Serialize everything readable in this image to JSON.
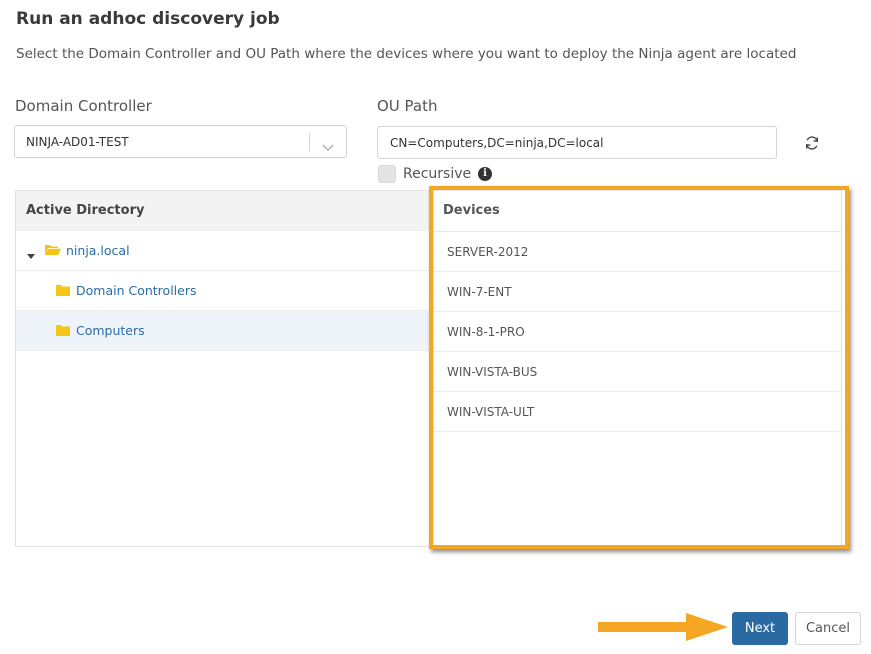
{
  "dialog": {
    "title": "Run an adhoc discovery job",
    "subtitle": "Select the Domain Controller and OU Path where the devices where you want to deploy the Ninja agent are located"
  },
  "domain_controller": {
    "label": "Domain Controller",
    "selected": "NINJA-AD01-TEST"
  },
  "ou_path": {
    "label": "OU Path",
    "value": "CN=Computers,DC=ninja,DC=local",
    "refresh_icon": "refresh-icon"
  },
  "recursive": {
    "label": "Recursive",
    "checked": false,
    "info_icon": "info-icon"
  },
  "active_directory": {
    "header": "Active Directory",
    "tree": [
      {
        "label": "ninja.local",
        "level": 0,
        "expanded": true,
        "icon": "folder-open-icon"
      },
      {
        "label": "Domain Controllers",
        "level": 1,
        "icon": "folder-icon"
      },
      {
        "label": "Computers",
        "level": 1,
        "icon": "folder-icon",
        "selected": true
      }
    ]
  },
  "devices": {
    "header": "Devices",
    "items": [
      "SERVER-2012",
      "WIN-7-ENT",
      "WIN-8-1-PRO",
      "WIN-VISTA-BUS",
      "WIN-VISTA-ULT"
    ]
  },
  "footer": {
    "next_label": "Next",
    "cancel_label": "Cancel"
  },
  "colors": {
    "primary": "#2a6aa3",
    "highlight": "#f5a623",
    "folder": "#f5c518",
    "link": "#2a6ca3"
  }
}
